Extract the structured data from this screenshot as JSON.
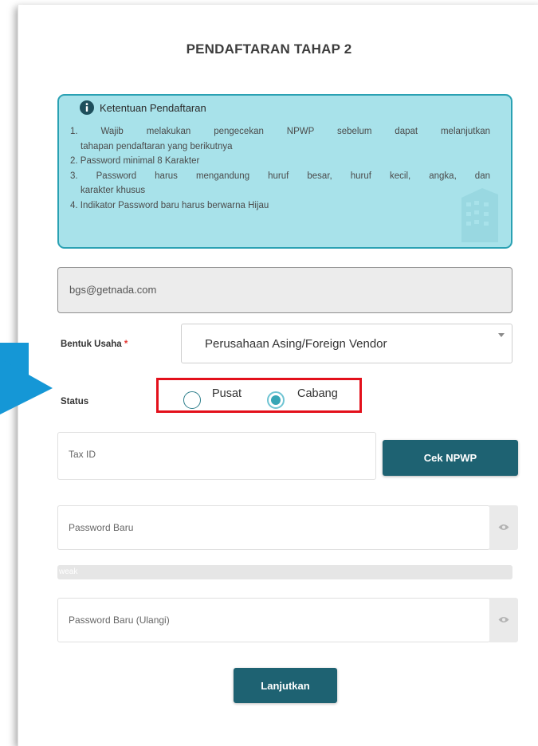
{
  "page": {
    "title": "PENDAFTARAN TAHAP 2"
  },
  "info": {
    "title": "Ketentuan Pendaftaran",
    "items": [
      "1. Wajib melakukan pengecekan NPWP sebelum dapat melanjutkan",
      "tahapan pendaftaran yang berikutnya",
      "2. Password minimal 8 Karakter",
      "3. Password harus mengandung huruf besar, huruf kecil, angka, dan",
      "karakter khusus",
      "4. Indikator Password baru harus berwarna Hijau"
    ]
  },
  "form": {
    "email": "bgs@getnada.com",
    "bentuk_usaha": {
      "label": "Bentuk Usaha",
      "required_mark": "*",
      "value": "Perusahaan Asing/Foreign Vendor"
    },
    "status": {
      "label": "Status",
      "options": [
        {
          "label": "Pusat",
          "checked": false
        },
        {
          "label": "Cabang",
          "checked": true
        }
      ]
    },
    "tax_id": {
      "placeholder": "Tax ID"
    },
    "cek_npwp_label": "Cek NPWP",
    "password": {
      "placeholder": "Password Baru",
      "strength_label": "weak",
      "strength": 0
    },
    "password_confirm": {
      "placeholder": "Password Baru (Ulangi)"
    },
    "submit_label": "Lanjutkan"
  },
  "colors": {
    "primary": "#1e6272",
    "info_bg": "#a8e2ea",
    "info_border": "#2aa1b3",
    "highlight": "#e3101b",
    "annotation_arrow": "#1597d6"
  }
}
